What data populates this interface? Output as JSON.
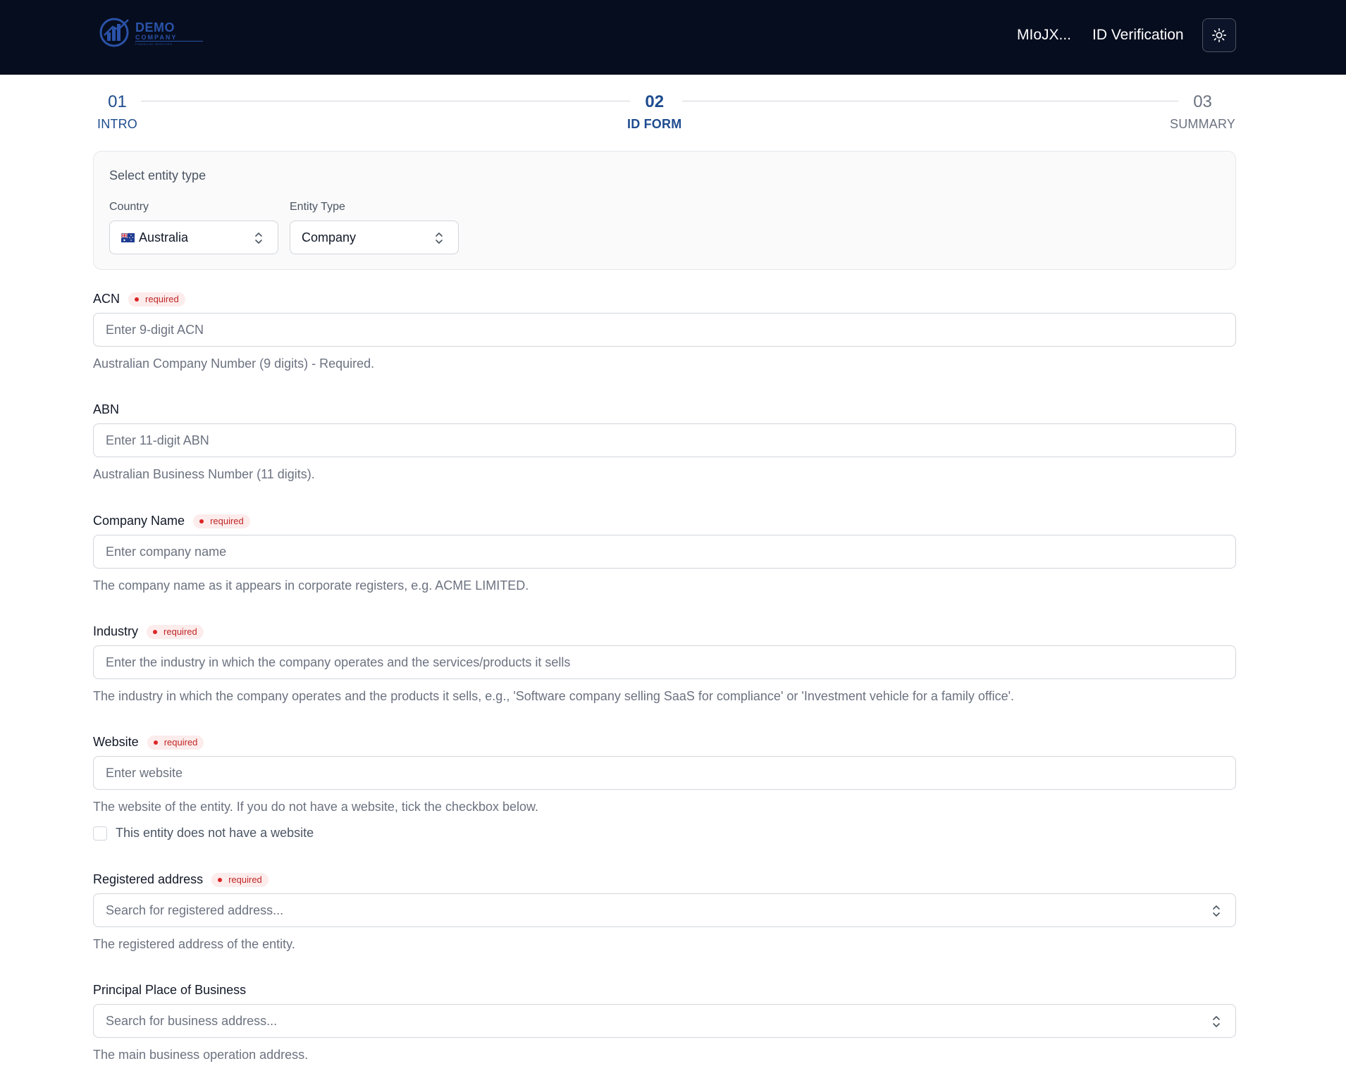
{
  "header": {
    "logo": {
      "line1": "DEMO",
      "line2": "COMPANY",
      "line3": "FINANCIAL SERVICES"
    },
    "user": "MIoJX...",
    "title": "ID Verification",
    "theme_icon": "sun-icon"
  },
  "stepper": [
    {
      "num": "01",
      "label": "INTRO",
      "state": "done"
    },
    {
      "num": "02",
      "label": "ID FORM",
      "state": "active"
    },
    {
      "num": "03",
      "label": "SUMMARY",
      "state": "upcoming"
    }
  ],
  "entity": {
    "title": "Select entity type",
    "country_label": "Country",
    "country_value": "Australia",
    "entity_type_label": "Entity Type",
    "entity_type_value": "Company"
  },
  "required_badge": "required",
  "fields": {
    "acn": {
      "label": "ACN",
      "placeholder": "Enter 9-digit ACN",
      "help": "Australian Company Number (9 digits) - Required."
    },
    "abn": {
      "label": "ABN",
      "placeholder": "Enter 11-digit ABN",
      "help": "Australian Business Number (11 digits)."
    },
    "company_name": {
      "label": "Company Name",
      "placeholder": "Enter company name",
      "help": "The company name as it appears in corporate registers, e.g. ACME LIMITED."
    },
    "industry": {
      "label": "Industry",
      "placeholder": "Enter the industry in which the company operates and the services/products it sells",
      "help": "The industry in which the company operates and the products it sells, e.g., 'Software company selling SaaS for compliance' or 'Investment vehicle for a family office'."
    },
    "website": {
      "label": "Website",
      "placeholder": "Enter website",
      "help": "The website of the entity. If you do not have a website, tick the checkbox below.",
      "checkbox_label": "This entity does not have a website"
    },
    "registered_address": {
      "label": "Registered address",
      "placeholder": "Search for registered address...",
      "help": "The registered address of the entity."
    },
    "principal_place": {
      "label": "Principal Place of Business",
      "placeholder": "Search for business address...",
      "help": "The main business operation address."
    }
  },
  "colors": {
    "header_bg": "#060d1e",
    "accent": "#1e4c8f",
    "required": "#dc2626"
  }
}
